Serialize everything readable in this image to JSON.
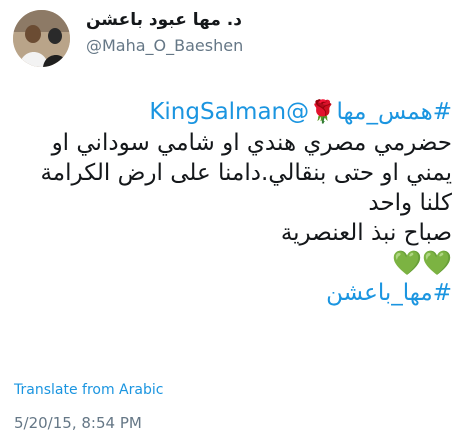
{
  "author": {
    "display_name": "د. مها عبود باعشن",
    "handle": "@Maha_O_Baeshen"
  },
  "tweet": {
    "hashtag_1": "#همس_مها",
    "rose_emoji": "🌹",
    "mention": "@KingSalman",
    "line_2": "حضرمي مصري هندي او شامي سوداني او",
    "line_3": "يمني او حتى بنقالي.دامنا على ارض الكرامة",
    "line_4": "كلنا واحد",
    "line_5": "صباح نبذ العنصرية",
    "hearts": "💚💚",
    "hashtag_2": "#مها_باعشن"
  },
  "translate_link": "Translate from Arabic",
  "timestamp": "5/20/15, 8:54 PM",
  "colors": {
    "link": "#1b95e0",
    "muted": "#657786",
    "heart": "#44c13a"
  }
}
